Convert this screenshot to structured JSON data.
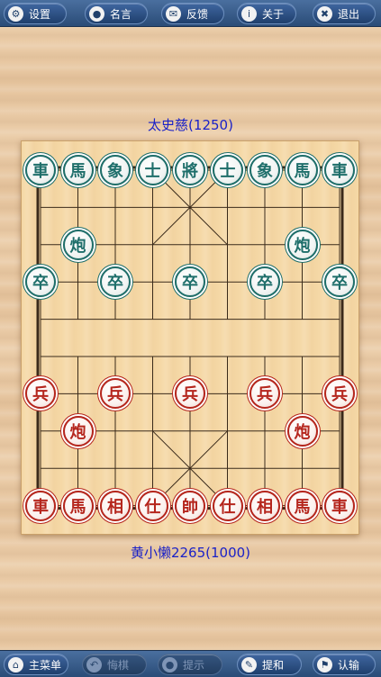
{
  "top_bar": {
    "buttons": [
      {
        "label": "设置",
        "icon": "gear-icon",
        "glyph": "⚙"
      },
      {
        "label": "名言",
        "icon": "chat-bubble-icon",
        "glyph": "●"
      },
      {
        "label": "反馈",
        "icon": "envelope-icon",
        "glyph": "✉"
      },
      {
        "label": "关于",
        "icon": "info-icon",
        "glyph": "i"
      },
      {
        "label": "退出",
        "icon": "close-icon",
        "glyph": "✖"
      }
    ]
  },
  "players": {
    "opponent": "太史慈(1250)",
    "self": "黄小懒2265(1000)"
  },
  "board": {
    "colors": {
      "black": "#1e6e6a",
      "red": "#b5261d",
      "line": "#3a2a1a"
    },
    "pieces": [
      {
        "side": "black",
        "char": "車",
        "file": 0,
        "rank": 0
      },
      {
        "side": "black",
        "char": "馬",
        "file": 1,
        "rank": 0
      },
      {
        "side": "black",
        "char": "象",
        "file": 2,
        "rank": 0
      },
      {
        "side": "black",
        "char": "士",
        "file": 3,
        "rank": 0
      },
      {
        "side": "black",
        "char": "將",
        "file": 4,
        "rank": 0
      },
      {
        "side": "black",
        "char": "士",
        "file": 5,
        "rank": 0
      },
      {
        "side": "black",
        "char": "象",
        "file": 6,
        "rank": 0
      },
      {
        "side": "black",
        "char": "馬",
        "file": 7,
        "rank": 0
      },
      {
        "side": "black",
        "char": "車",
        "file": 8,
        "rank": 0
      },
      {
        "side": "black",
        "char": "炮",
        "file": 1,
        "rank": 2
      },
      {
        "side": "black",
        "char": "炮",
        "file": 7,
        "rank": 2
      },
      {
        "side": "black",
        "char": "卒",
        "file": 0,
        "rank": 3
      },
      {
        "side": "black",
        "char": "卒",
        "file": 2,
        "rank": 3
      },
      {
        "side": "black",
        "char": "卒",
        "file": 4,
        "rank": 3
      },
      {
        "side": "black",
        "char": "卒",
        "file": 6,
        "rank": 3
      },
      {
        "side": "black",
        "char": "卒",
        "file": 8,
        "rank": 3
      },
      {
        "side": "red",
        "char": "兵",
        "file": 0,
        "rank": 6
      },
      {
        "side": "red",
        "char": "兵",
        "file": 2,
        "rank": 6
      },
      {
        "side": "red",
        "char": "兵",
        "file": 4,
        "rank": 6
      },
      {
        "side": "red",
        "char": "兵",
        "file": 6,
        "rank": 6
      },
      {
        "side": "red",
        "char": "兵",
        "file": 8,
        "rank": 6
      },
      {
        "side": "red",
        "char": "炮",
        "file": 1,
        "rank": 7
      },
      {
        "side": "red",
        "char": "炮",
        "file": 7,
        "rank": 7
      },
      {
        "side": "red",
        "char": "車",
        "file": 0,
        "rank": 9
      },
      {
        "side": "red",
        "char": "馬",
        "file": 1,
        "rank": 9
      },
      {
        "side": "red",
        "char": "相",
        "file": 2,
        "rank": 9
      },
      {
        "side": "red",
        "char": "仕",
        "file": 3,
        "rank": 9
      },
      {
        "side": "red",
        "char": "帥",
        "file": 4,
        "rank": 9
      },
      {
        "side": "red",
        "char": "仕",
        "file": 5,
        "rank": 9
      },
      {
        "side": "red",
        "char": "相",
        "file": 6,
        "rank": 9
      },
      {
        "side": "red",
        "char": "馬",
        "file": 7,
        "rank": 9
      },
      {
        "side": "red",
        "char": "車",
        "file": 8,
        "rank": 9
      }
    ]
  },
  "bottom_bar": {
    "buttons": [
      {
        "label": "主菜单",
        "icon": "home-icon",
        "glyph": "⌂",
        "enabled": true
      },
      {
        "label": "悔棋",
        "icon": "undo-icon",
        "glyph": "↶",
        "enabled": false
      },
      {
        "label": "提示",
        "icon": "bell-icon",
        "glyph": "●",
        "enabled": false
      },
      {
        "label": "提和",
        "icon": "pen-icon",
        "glyph": "✎",
        "enabled": true
      },
      {
        "label": "认输",
        "icon": "flag-icon",
        "glyph": "⚑",
        "enabled": true
      }
    ]
  }
}
